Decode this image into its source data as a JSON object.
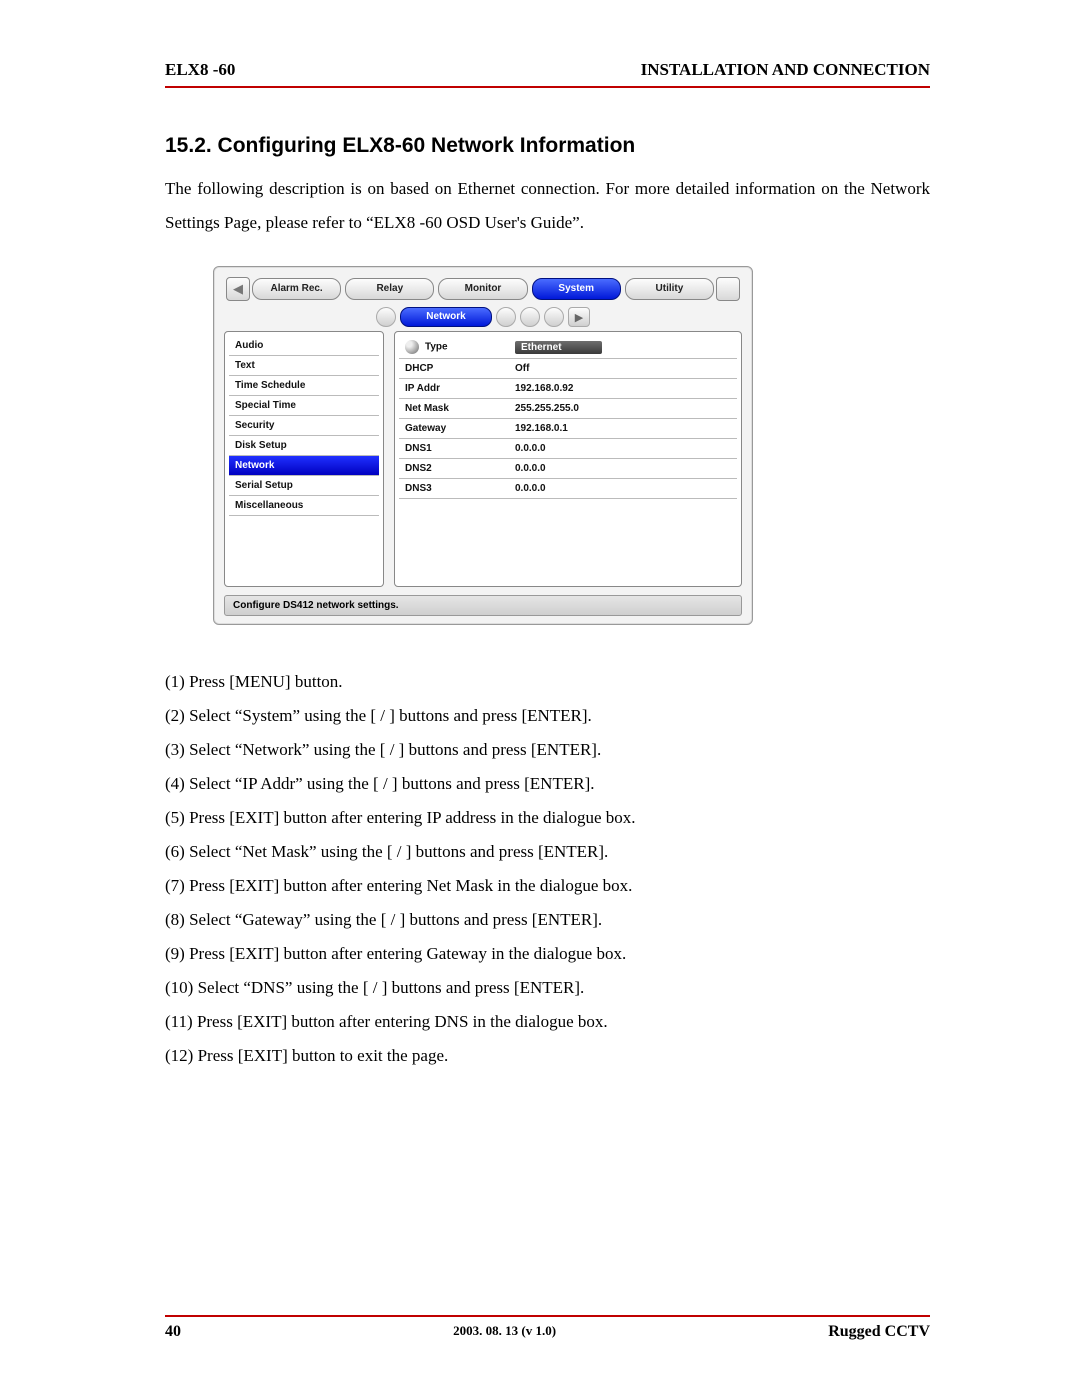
{
  "header": {
    "left": "ELX8 -60",
    "right": "INSTALLATION AND CONNECTION"
  },
  "section": {
    "title": "15.2. Configuring ELX8-60 Network Information",
    "intro": "The following description is on based on Ethernet connection. For more detailed information on the Network Settings Page, please refer to “ELX8 -60 OSD User's Guide”."
  },
  "osd": {
    "tabs": [
      "Alarm Rec.",
      "Relay",
      "Monitor",
      "System",
      "Utility"
    ],
    "active_tab_index": 3,
    "subtab": "Network",
    "left_menu": [
      "Audio",
      "Text",
      "Time Schedule",
      "Special Time",
      "Security",
      "Disk Setup",
      "Network",
      "Serial Setup",
      "Miscellaneous"
    ],
    "left_selected_index": 6,
    "rows": [
      {
        "k": "Type",
        "v": "Ethernet"
      },
      {
        "k": "DHCP",
        "v": "Off"
      },
      {
        "k": "IP Addr",
        "v": "192.168.0.92"
      },
      {
        "k": "Net Mask",
        "v": "255.255.255.0"
      },
      {
        "k": "Gateway",
        "v": "192.168.0.1"
      },
      {
        "k": "DNS1",
        "v": "0.0.0.0"
      },
      {
        "k": "DNS2",
        "v": "0.0.0.0"
      },
      {
        "k": "DNS3",
        "v": "0.0.0.0"
      }
    ],
    "status": "Configure DS412 network settings."
  },
  "steps": [
    "(1)  Press [MENU] button.",
    "(2)  Select “System” using the [       /       ] buttons and press [ENTER].",
    "(3)  Select “Network” using the [   /   ] buttons and press [ENTER].",
    "(4)  Select “IP Addr” using the [   /   ] buttons and press [ENTER].",
    "(5)  Press [EXIT] button after entering IP address in the dialogue box.",
    "(6)  Select “Net Mask” using the [   /   ] buttons and press [ENTER].",
    "(7)  Press [EXIT] button after entering Net Mask in the dialogue box.",
    "(8)  Select “Gateway” using the [   /   ] buttons and press [ENTER].",
    "(9)  Press [EXIT] button after entering Gateway in the dialogue box.",
    "(10)  Select “DNS” using the [   /   ] buttons and press [ENTER].",
    "(11)  Press [EXIT] button after entering DNS  in the dialogue box.",
    "(12)  Press [EXIT] button to exit the page."
  ],
  "footer": {
    "page": "40",
    "center": "2003. 08. 13  (v 1.0)",
    "right": "Rugged CCTV"
  }
}
